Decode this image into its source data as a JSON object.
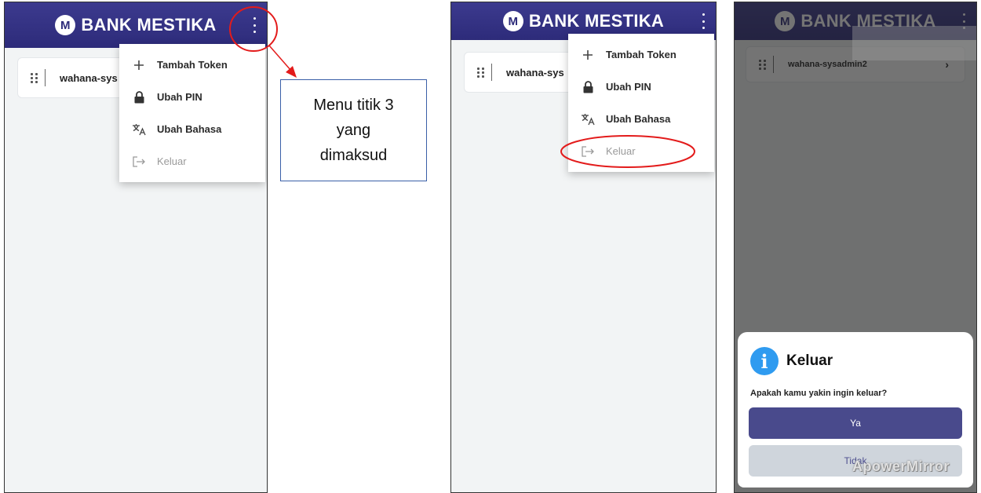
{
  "app": {
    "brand": "BANK MESTIKA",
    "logo_letter": "M"
  },
  "account": {
    "name_cropped": "wahana-sys",
    "name_full": "wahana-sysadmin2"
  },
  "menu": {
    "items": [
      {
        "label": "Tambah Token",
        "icon": "plus-icon"
      },
      {
        "label": "Ubah PIN",
        "icon": "lock-icon"
      },
      {
        "label": "Ubah Bahasa",
        "icon": "translate-icon"
      },
      {
        "label": "Keluar",
        "icon": "logout-icon"
      }
    ]
  },
  "callout": {
    "line1": "Menu titik 3",
    "line2": "yang",
    "line3": "dimaksud"
  },
  "dialog": {
    "title": "Keluar",
    "message": "Apakah kamu yakin ingin keluar?",
    "yes_label": "Ya",
    "no_label": "Tidak"
  },
  "watermark": "ApowerMirror",
  "colors": {
    "appbar": "#2d2b7a",
    "annotation": "#e31b1b",
    "primary_button": "#494a8c",
    "info": "#2f9bf0"
  }
}
